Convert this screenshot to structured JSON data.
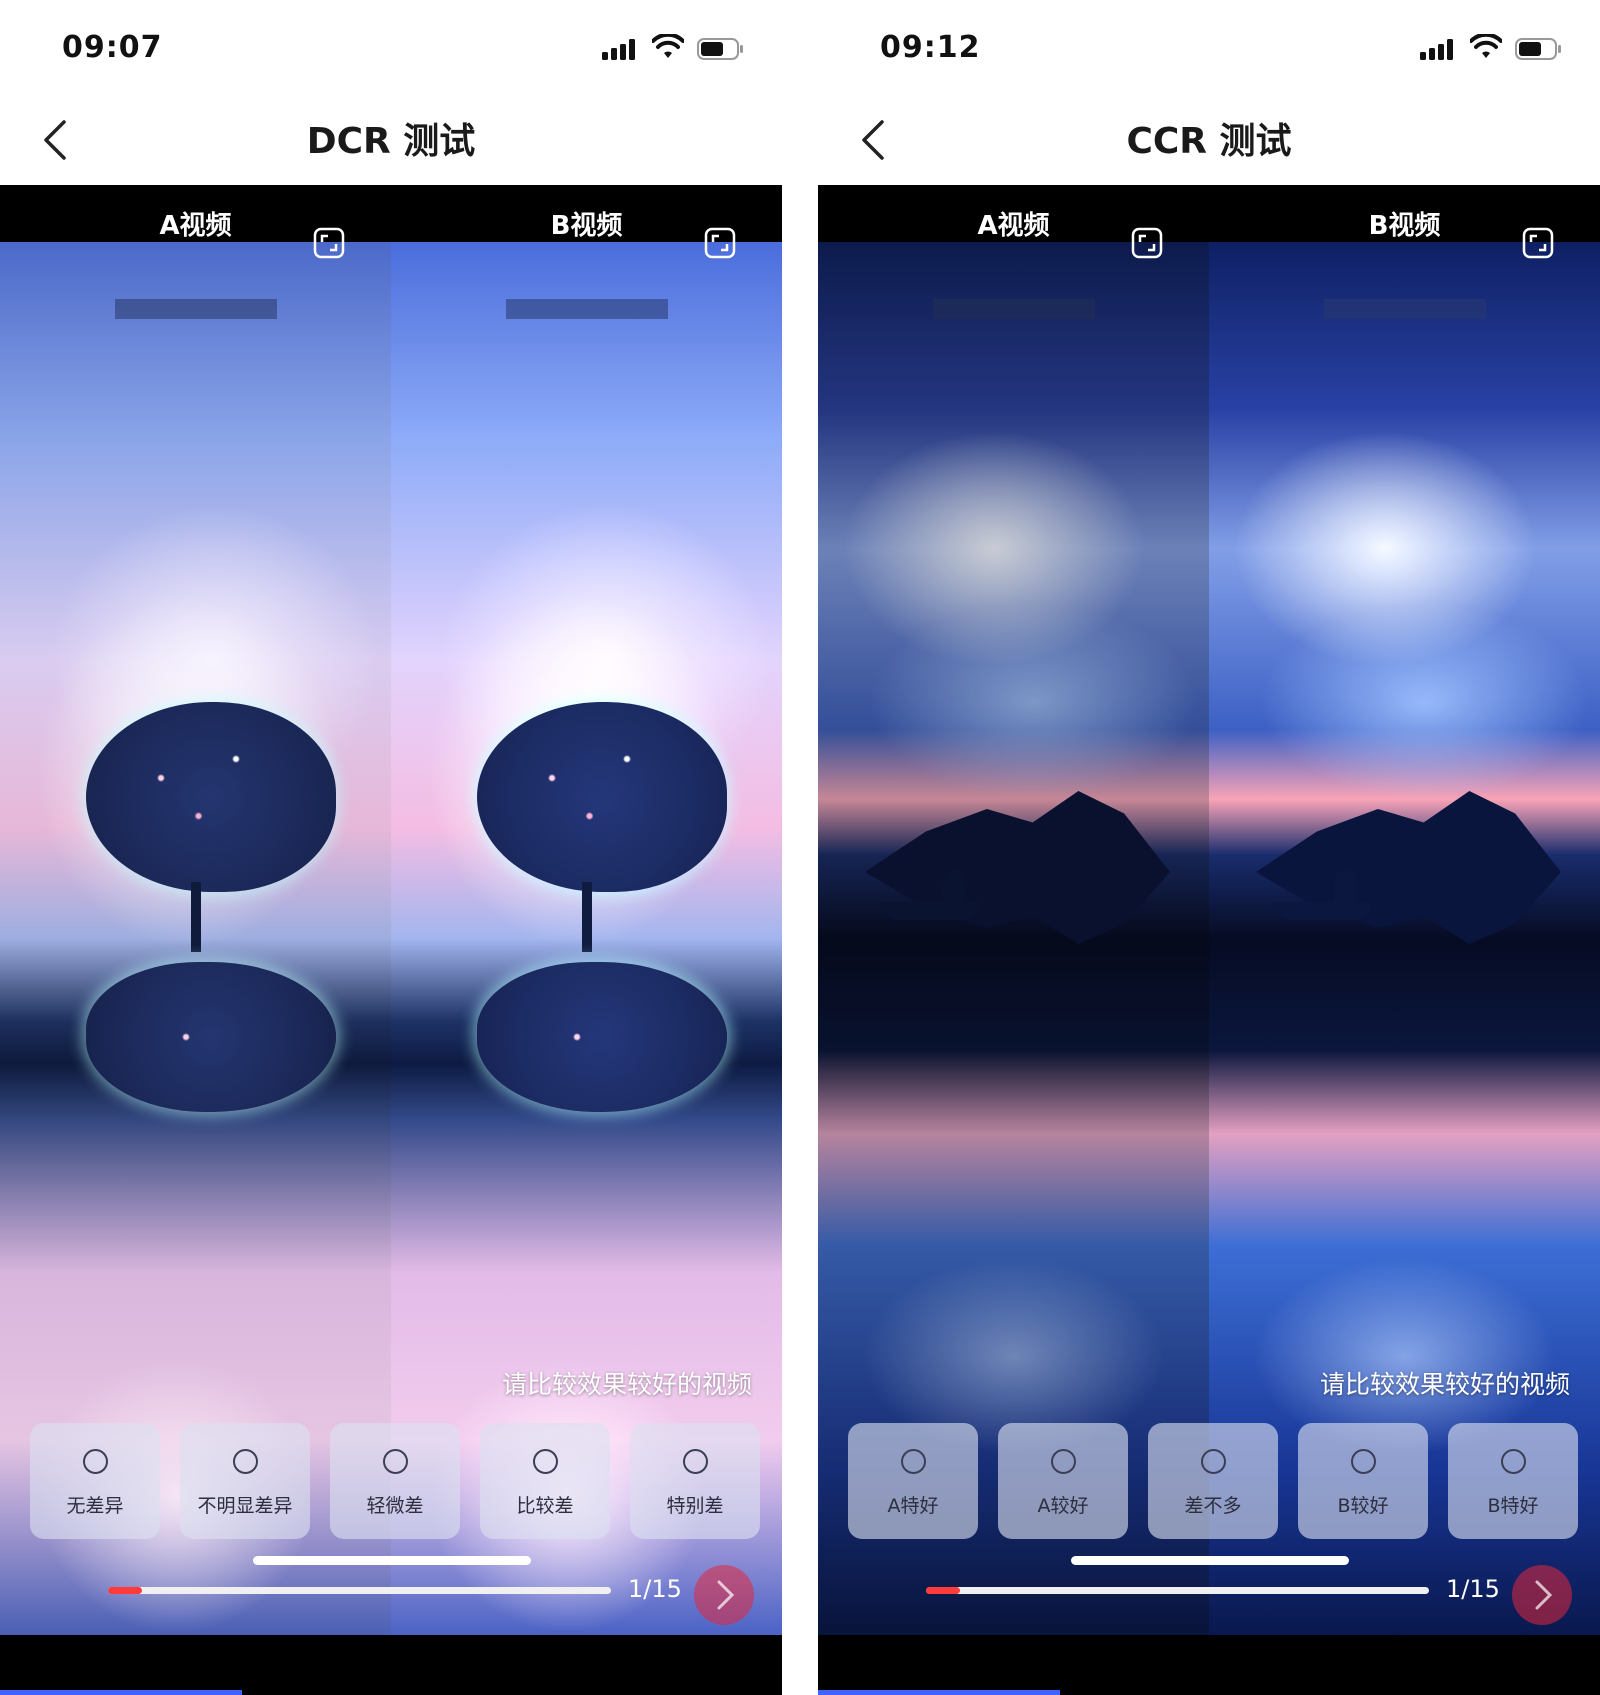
{
  "screens": [
    {
      "status": {
        "time": "09:07"
      },
      "nav": {
        "title": "DCR 测试"
      },
      "videos": {
        "a_label": "A视频",
        "b_label": "B视频"
      },
      "prompt": "请比较效果较好的视频",
      "options": [
        "无差异",
        "不明显差异",
        "轻微差",
        "比较差",
        "特别差"
      ],
      "progress": {
        "fraction": 0.0667,
        "text": "1/15"
      }
    },
    {
      "status": {
        "time": "09:12"
      },
      "nav": {
        "title": "CCR 测试"
      },
      "videos": {
        "a_label": "A视频",
        "b_label": "B视频"
      },
      "prompt": "请比较效果较好的视频",
      "options": [
        "A特好",
        "A较好",
        "差不多",
        "B较好",
        "B特好"
      ],
      "progress": {
        "fraction": 0.0667,
        "text": "1/15"
      }
    }
  ],
  "colors": {
    "accent_red": "#ff3b3b",
    "home_indicator": "#ffffff",
    "video_header_bg": "#000000"
  },
  "icons": [
    "signal-icon",
    "wifi-icon",
    "battery-icon",
    "back-icon",
    "fullscreen-icon",
    "chevron-right-icon"
  ]
}
